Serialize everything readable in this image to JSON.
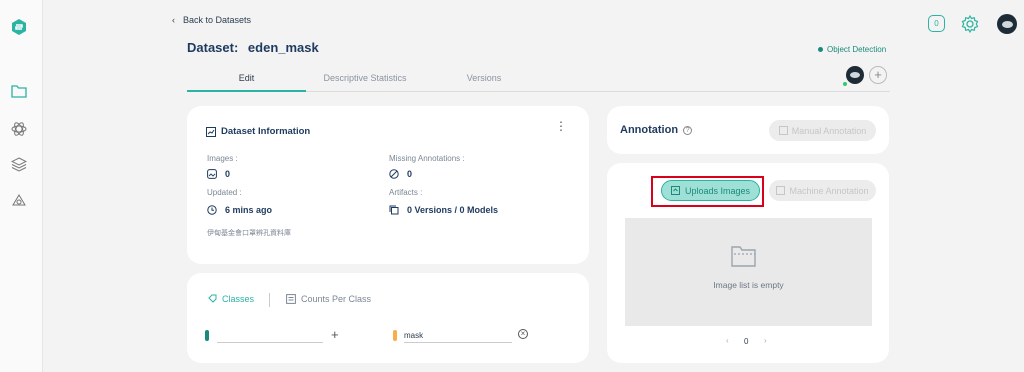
{
  "nav": {
    "back_label": "Back to Datasets",
    "notification_count": "0"
  },
  "dataset": {
    "title_label": "Dataset:",
    "name": "eden_mask",
    "task_type": "Object Detection"
  },
  "tabs": [
    {
      "label": "Edit",
      "active": true
    },
    {
      "label": "Descriptive Statistics",
      "active": false
    },
    {
      "label": "Versions",
      "active": false
    }
  ],
  "info": {
    "title": "Dataset Information",
    "images_label": "Images :",
    "images_value": "0",
    "missing_label": "Missing Annotations :",
    "missing_value": "0",
    "updated_label": "Updated :",
    "updated_value": "6 mins ago",
    "artifacts_label": "Artifacts :",
    "artifacts_value": "0 Versions / 0 Models",
    "description": "伊甸基金會口罩辨孔資料庫"
  },
  "classes": {
    "tab_classes": "Classes",
    "tab_counts": "Counts Per Class",
    "new_class_placeholder": "",
    "items": [
      {
        "name": "mask",
        "color": "#f5b04a"
      }
    ]
  },
  "annotation": {
    "title": "Annotation",
    "manual_button": "Manual Annotation",
    "upload_button": "Uploads Images",
    "machine_button": "Machine Annotation",
    "empty_text": "Image list is empty",
    "page_number": "0"
  },
  "colors": {
    "accent": "#2bb3a3",
    "teal_dark": "#1a8a7c",
    "highlight": "#d9001b"
  }
}
